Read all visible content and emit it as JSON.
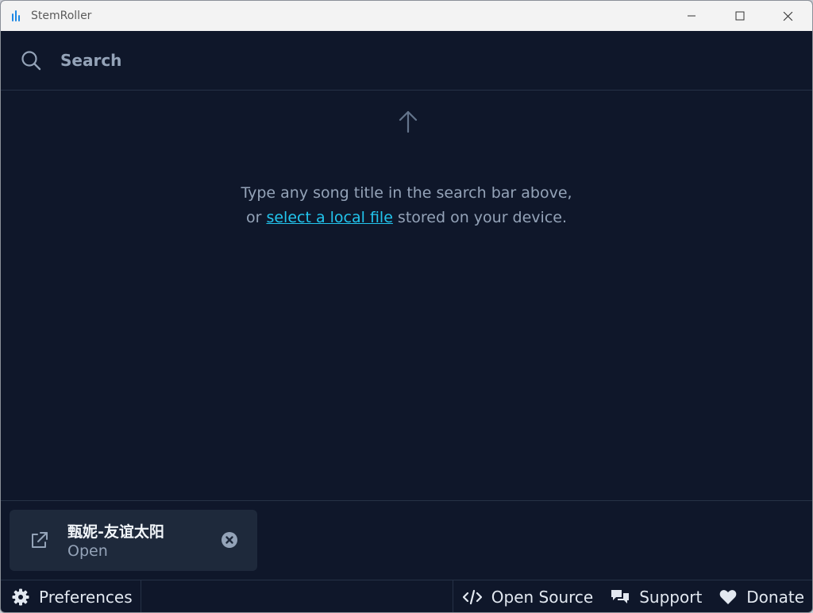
{
  "window": {
    "title": "StemRoller"
  },
  "search": {
    "placeholder": "Search",
    "value": ""
  },
  "main": {
    "hint_line1": "Type any song title in the search bar above,",
    "hint_line2_prefix": "or ",
    "hint_link": "select a local file",
    "hint_line2_suffix": " stored on your device."
  },
  "queue": {
    "items": [
      {
        "title": "甄妮-友谊太阳",
        "status": "Open"
      }
    ]
  },
  "footer": {
    "preferences": "Preferences",
    "open_source": "Open Source",
    "support": "Support",
    "donate": "Donate"
  },
  "colors": {
    "background": "#0f172a",
    "card": "#1e293b",
    "accent": "#22c5ee",
    "muted": "#94a3b8"
  },
  "icons": [
    "app-logo-icon",
    "minimize-icon",
    "maximize-icon",
    "close-icon",
    "search-icon",
    "arrow-up-icon",
    "external-link-icon",
    "remove-circle-icon",
    "gear-icon",
    "code-icon",
    "chat-icon",
    "heart-icon"
  ]
}
